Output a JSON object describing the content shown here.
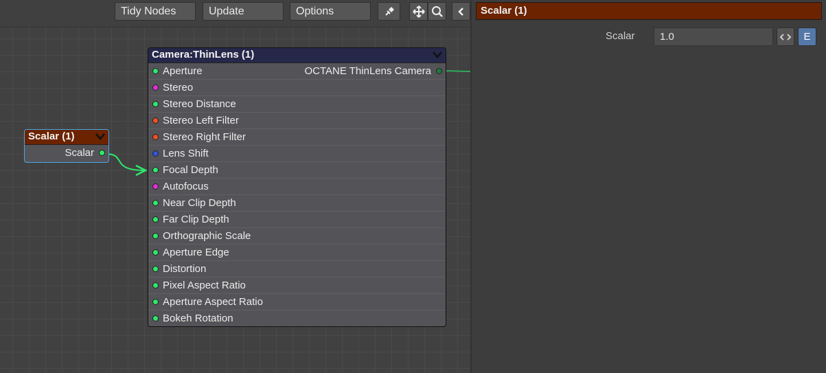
{
  "toolbar": {
    "tidy_label": "Tidy Nodes",
    "update_label": "Update",
    "options_label": "Options",
    "icons": [
      "pin-icon",
      "move-icon",
      "search-icon",
      "chevron-left-icon"
    ]
  },
  "camera_node": {
    "title": "Camera:ThinLens (1)",
    "output_label": "OCTANE ThinLens Camera",
    "inputs": [
      {
        "label": "Aperture",
        "color": "#2ee86b"
      },
      {
        "label": "Stereo",
        "color": "#e030d8"
      },
      {
        "label": "Stereo Distance",
        "color": "#2ee86b"
      },
      {
        "label": "Stereo Left Filter",
        "color": "#f05024"
      },
      {
        "label": "Stereo Right Filter",
        "color": "#f05024"
      },
      {
        "label": "Lens Shift",
        "color": "#3055e8"
      },
      {
        "label": "Focal Depth",
        "color": "#2ee86b"
      },
      {
        "label": "Autofocus",
        "color": "#e030d8"
      },
      {
        "label": "Near Clip Depth",
        "color": "#2ee86b"
      },
      {
        "label": "Far Clip Depth",
        "color": "#2ee86b"
      },
      {
        "label": "Orthographic Scale",
        "color": "#2ee86b"
      },
      {
        "label": "Aperture Edge",
        "color": "#2ee86b"
      },
      {
        "label": "Distortion",
        "color": "#2ee86b"
      },
      {
        "label": "Pixel Aspect Ratio",
        "color": "#2ee86b"
      },
      {
        "label": "Aperture Aspect Ratio",
        "color": "#2ee86b"
      },
      {
        "label": "Bokeh Rotation",
        "color": "#2ee86b"
      }
    ]
  },
  "scalar_node": {
    "title": "Scalar (1)",
    "output_label": "Scalar",
    "output_color": "#2ee86b"
  },
  "panel": {
    "title": "Scalar (1)",
    "field_label": "Scalar",
    "field_value": "1.0",
    "env_label": "E"
  },
  "colors": {
    "connection": "#2ee86b",
    "scalar_header": "#6b2300",
    "camera_header": "#26284a"
  }
}
